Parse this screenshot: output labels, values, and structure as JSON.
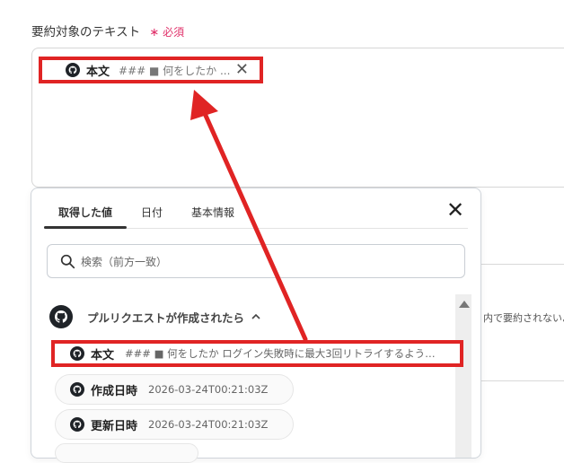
{
  "field": {
    "label": "要約対象のテキスト",
    "required_label": "必須"
  },
  "selected_chip": {
    "name": "本文",
    "value": "### ■ 何をしたか ...",
    "close": "✕"
  },
  "background_text": "内で要約されないよ",
  "popup": {
    "tabs": [
      {
        "label": "取得した値",
        "active": true
      },
      {
        "label": "日付",
        "active": false
      },
      {
        "label": "基本情報",
        "active": false
      }
    ],
    "close": "✕",
    "search_placeholder": "検索（前方一致）",
    "group": {
      "title": "プルリクエストが作成されたら",
      "expanded": true
    },
    "items": [
      {
        "name": "本文",
        "value": "### ■ 何をしたか ログイン失敗時に最大3回リトライするよう…"
      },
      {
        "name": "作成日時",
        "value": "2026-03-24T00:21:03Z"
      },
      {
        "name": "更新日時",
        "value": "2026-03-24T00:21:03Z"
      }
    ]
  },
  "colors": {
    "highlight": "#e02424",
    "required": "#e0316a"
  }
}
